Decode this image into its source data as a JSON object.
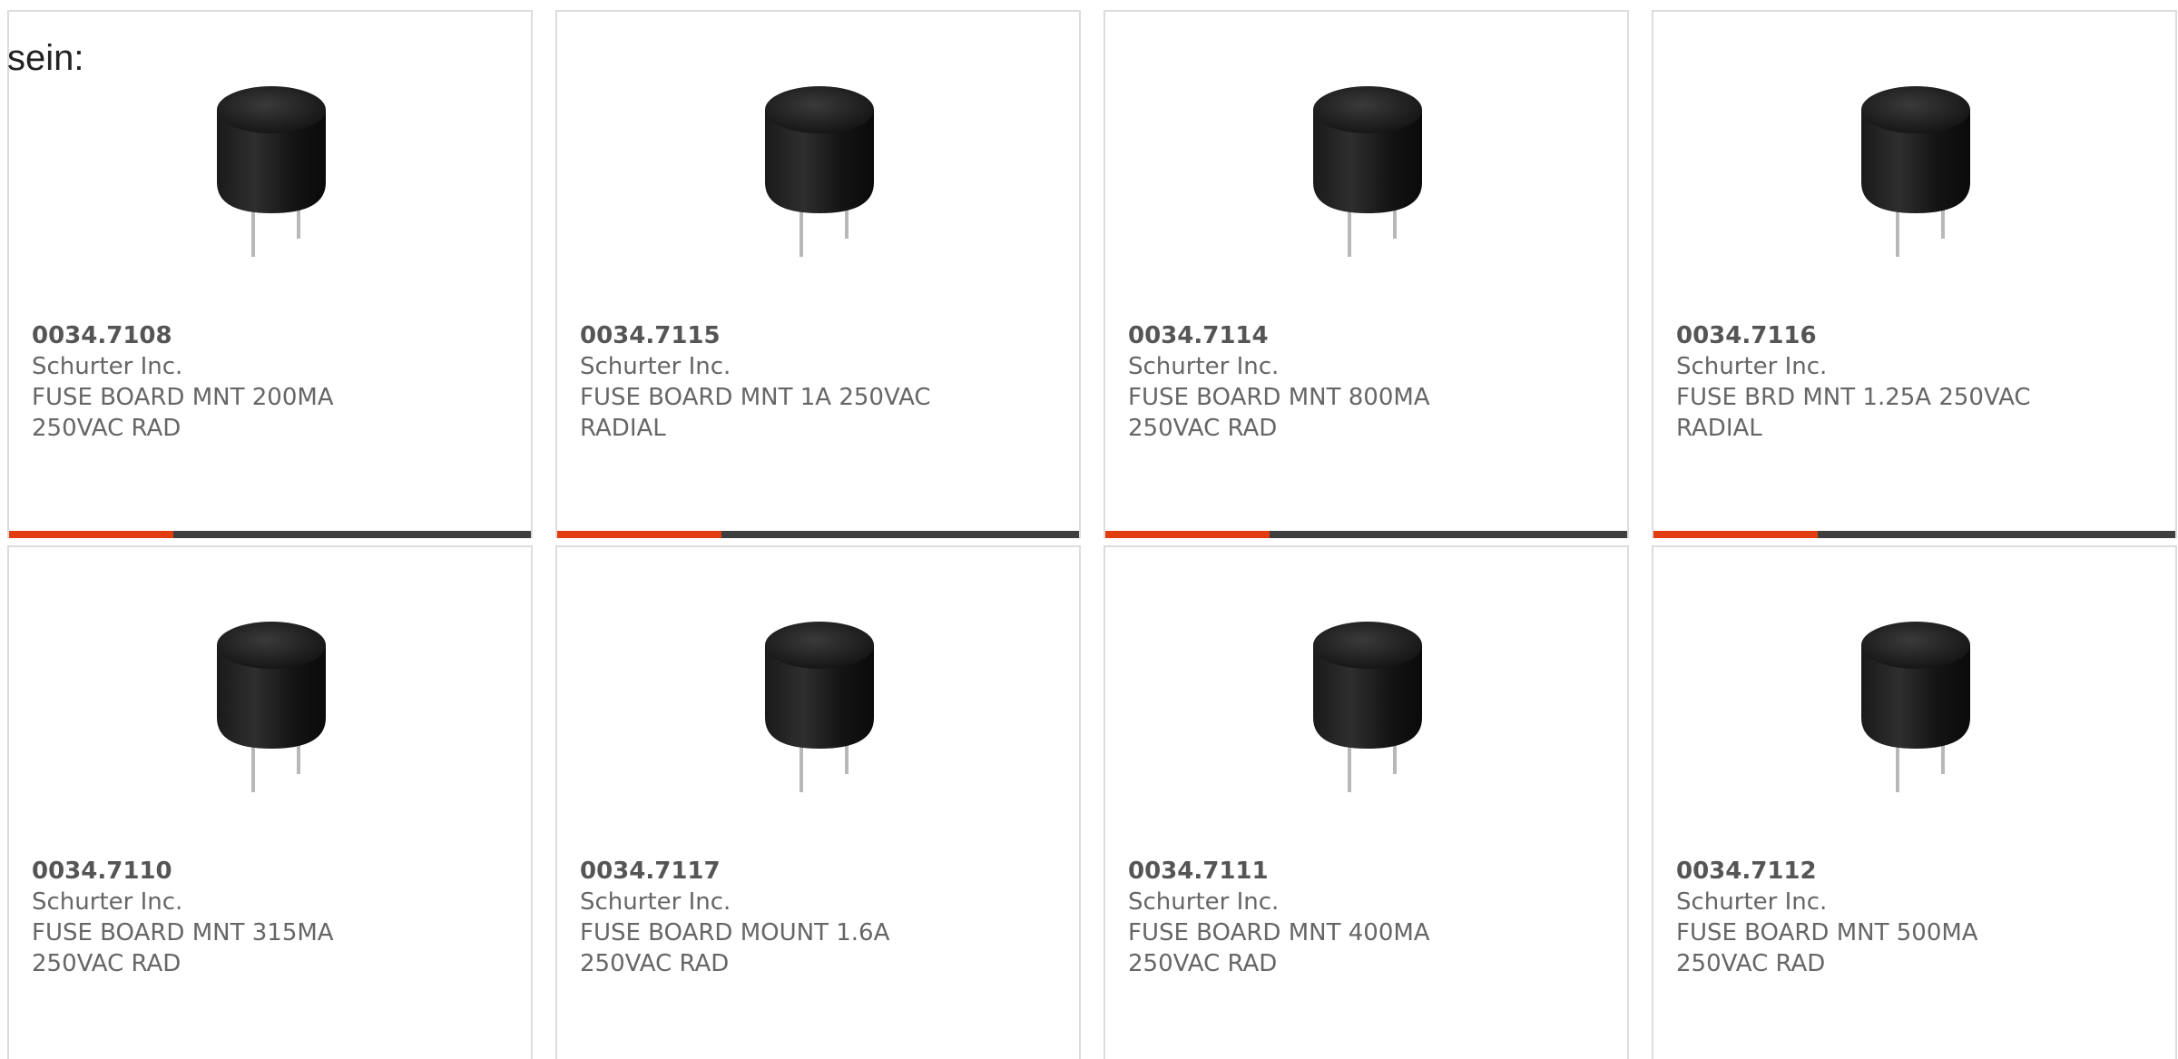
{
  "intro_text": "sein:",
  "accent_color": "#e23d10",
  "bar_color": "#3f3f3f",
  "products": [
    {
      "part_number": "0034.7108",
      "manufacturer": "Schurter Inc.",
      "description": "FUSE BOARD MNT 200MA 250VAC RAD",
      "image_icon": "radial-fuse-image"
    },
    {
      "part_number": "0034.7115",
      "manufacturer": "Schurter Inc.",
      "description": "FUSE BOARD MNT 1A 250VAC RADIAL",
      "image_icon": "radial-fuse-image"
    },
    {
      "part_number": "0034.7114",
      "manufacturer": "Schurter Inc.",
      "description": "FUSE BOARD MNT 800MA 250VAC RAD",
      "image_icon": "radial-fuse-image"
    },
    {
      "part_number": "0034.7116",
      "manufacturer": "Schurter Inc.",
      "description": "FUSE BRD MNT 1.25A 250VAC RADIAL",
      "image_icon": "radial-fuse-image"
    },
    {
      "part_number": "0034.7110",
      "manufacturer": "Schurter Inc.",
      "description": "FUSE BOARD MNT 315MA 250VAC RAD",
      "image_icon": "radial-fuse-image"
    },
    {
      "part_number": "0034.7117",
      "manufacturer": "Schurter Inc.",
      "description": "FUSE BOARD MOUNT 1.6A 250VAC RAD",
      "image_icon": "radial-fuse-image"
    },
    {
      "part_number": "0034.7111",
      "manufacturer": "Schurter Inc.",
      "description": "FUSE BOARD MNT 400MA 250VAC RAD",
      "image_icon": "radial-fuse-image"
    },
    {
      "part_number": "0034.7112",
      "manufacturer": "Schurter Inc.",
      "description": "FUSE BOARD MNT 500MA 250VAC RAD",
      "image_icon": "radial-fuse-image"
    }
  ]
}
